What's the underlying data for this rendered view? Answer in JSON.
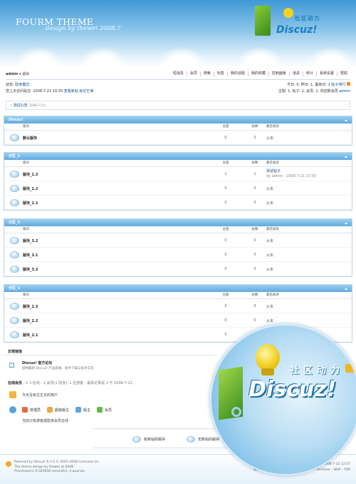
{
  "header": {
    "site_title": "FOURM THEME",
    "site_subtitle": "design by thewei 2008.7",
    "logo_cn": "社区动力",
    "logo_en": "Discuz!"
  },
  "topbar": {
    "username": "admin",
    "logout": "退出",
    "nav": [
      "短消息",
      "会员",
      "搜索",
      "标签",
      "我的话题",
      "我的收藏",
      "控制面板",
      "道具",
      "统计",
      "系统设置",
      "帮助"
    ]
  },
  "status": {
    "state_label": "状态:",
    "state_value": "隐身模式",
    "last_visit": "您上次访问是在: 2008-7-21 19:35",
    "view_new": "查看新帖",
    "mark_read": "标记已读",
    "today": "今日: 0, 昨日: 1, 最高日: 1",
    "ranking": "帖子排行",
    "stats": "主题: 1, 帖子: 1, 会员: 1, 欢迎新会员",
    "new_member": "admin"
  },
  "notice": {
    "title": "测试公告",
    "date": "(2008-7-21)"
  },
  "columns": {
    "forum": "版块",
    "topics": "主题",
    "posts": "帖数",
    "last": "最后发表"
  },
  "categories": [
    {
      "title": "Discuz!",
      "forums": [
        {
          "name": "默认版块",
          "topics": "0",
          "posts": "0",
          "last": "从未",
          "last_by": ""
        }
      ]
    },
    {
      "title": "分区_1",
      "forums": [
        {
          "name": "版块_1.3",
          "topics": "1",
          "posts": "1",
          "last": "测试帖子",
          "last_by": "by admin - 2008-7-21 17:50"
        },
        {
          "name": "版块_1.2",
          "topics": "0",
          "posts": "0",
          "last": "从未",
          "last_by": ""
        },
        {
          "name": "版块_1.1",
          "topics": "0",
          "posts": "0",
          "last": "从未",
          "last_by": ""
        }
      ]
    },
    {
      "title": "分区_3",
      "forums": [
        {
          "name": "版块_3.2",
          "topics": "0",
          "posts": "0",
          "last": "从未",
          "last_by": ""
        },
        {
          "name": "版块_3.1",
          "topics": "0",
          "posts": "0",
          "last": "从未",
          "last_by": ""
        },
        {
          "name": "版块_3.3",
          "topics": "0",
          "posts": "0",
          "last": "从未",
          "last_by": ""
        }
      ]
    },
    {
      "title": "分区_2",
      "forums": [
        {
          "name": "版块_2.3",
          "topics": "0",
          "posts": "0",
          "last": "从未",
          "last_by": ""
        },
        {
          "name": "版块_2.2",
          "topics": "0",
          "posts": "0",
          "last": "从未",
          "last_by": ""
        },
        {
          "name": "版块_2.1",
          "topics": "0",
          "posts": "0",
          "last": "从未",
          "last_by": ""
        }
      ]
    }
  ],
  "links": {
    "title": "友情链接",
    "name": "Discuz! 官方论坛",
    "desc": "提供最新 Discuz! 产品新闻、软件下载与技术交流"
  },
  "online": {
    "title": "在线会员",
    "summary": "- 2 人在线 - 1 会员(1 隐身), 1 位游客 - 最高记录是 2 于 2008-7-21.",
    "birthday": "今天没有过生日的用户",
    "roles": [
      "管理员",
      "超级版主",
      "版主",
      "会员"
    ],
    "note": "当前只有游客或隐身会员在线"
  },
  "legend": {
    "new": "有新帖的版块",
    "none": "无新帖的版块"
  },
  "footer": {
    "powered": "Powered by Discuz! 6.1.0 © 2001-2008 Comsenz Inc.",
    "theme": "The theme design by thewei at 2008",
    "processed": "Processed in 0.023658 second(s), 4 queries.",
    "time": "GMT+8, 现在时间是 2008-7-22 12:57",
    "links": "清除 Cookies - 联系我们 - Comsenz Inc. - Archiver - WAP - TOP"
  },
  "colors": {
    "category_header": "#5fa9df",
    "link": "#0b4a8a",
    "accent": "#f1b522"
  }
}
